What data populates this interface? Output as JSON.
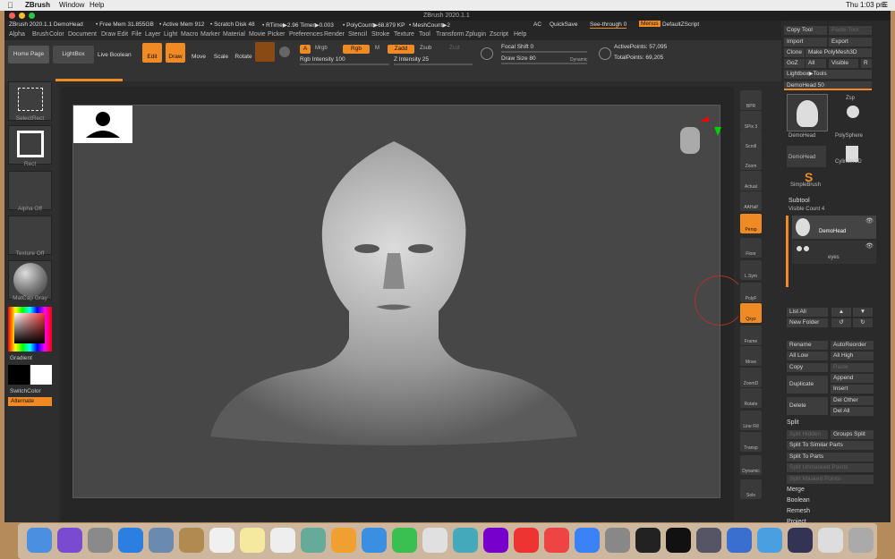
{
  "mac_menubar": {
    "app": "ZBrush",
    "window": "Window",
    "help": "Help",
    "clock": "Thu 1:03 pm"
  },
  "window": {
    "title": "ZBrush 2020.1.1"
  },
  "status_bar": {
    "app": "ZBrush 2020.1.1 DemoHead",
    "free_mem": "• Free Mem 31.855GB",
    "active_mem": "• Active Mem 912",
    "scratch": "• Scratch Disk 48",
    "rtime": "• RTime▶2.96 Timer▶0.003",
    "polycount": "• PolyCount▶68.879 KP",
    "meshcount": "• MeshCount▶2",
    "ac": "AC",
    "quicksave": "QuickSave",
    "seethrough": "See-through 0",
    "menus": "Menus",
    "script": "DefaultZScript"
  },
  "main_menu": [
    "Alpha",
    "Brush",
    "Color",
    "Document",
    "Draw",
    "Edit",
    "File",
    "Layer",
    "Light",
    "Macro",
    "Marker",
    "Material",
    "Movie",
    "Picker",
    "Preferences",
    "Render",
    "Stencil",
    "Stroke",
    "Texture",
    "Tool",
    "Transform",
    "Zplugin",
    "Zscript",
    "Help"
  ],
  "toolbar": {
    "home": "Home Page",
    "lightbox": "LightBox",
    "liveboolean": "Live Boolean",
    "edit": "Edit",
    "draw": "Draw",
    "move": "Move",
    "scale": "Scale",
    "rotate": "Rotate",
    "a": "A",
    "mrgb": "Mrgb",
    "rgb": "Rgb",
    "m": "M",
    "rgb_intensity": "Rgb Intensity 100",
    "zadd": "Zadd",
    "zsub": "Zsub",
    "zcut": "Zcut",
    "z_intensity": "Z Intensity 25",
    "focal_shift": "Focal Shift 0",
    "draw_size": "Draw Size 80",
    "dynamic": "Dynamic",
    "active_points": "ActivePoints: 57,095",
    "total_points": "TotalPoints: 69,205"
  },
  "left_panel": {
    "selectrect": "SelectRect",
    "rect": "Rect",
    "alpha_off": "Alpha Off",
    "texture_off": "Texture Off",
    "matcap": "MatCap Gray",
    "gradient": "Gradient",
    "switchcolor": "SwitchColor",
    "alternate": "Alternate"
  },
  "right_strip": [
    "BPR",
    "SPix 3",
    "Scroll",
    "Zoom",
    "Actual",
    "AAHalf",
    "Persp",
    "Floor",
    "L.Sym",
    "PolyF",
    "Qxyz",
    "Frame",
    "Move",
    "ZoomD",
    "Rotate",
    "Line Fill",
    "Transp",
    "Dynamic",
    "Solo"
  ],
  "right_panel": {
    "copy_tool": "Copy Tool",
    "paste_tool": "Paste Tool",
    "import": "Import",
    "export": "Export",
    "clone": "Clone",
    "make_polymesh": "Make PolyMesh3D",
    "goz": "GoZ",
    "all": "All",
    "visible": "Visible",
    "r": "R",
    "lightbox_tools": "Lightbox▶Tools",
    "demohead_slider": "DemoHead 50",
    "tools": [
      "DemoHead",
      "Zsp",
      "PolySphere",
      "DemoHead",
      "Cylinder3D",
      "SimpleBrush"
    ],
    "subtool": "Subtool",
    "visible_count": "Visible Count 4",
    "subtool_items": [
      "DemoHead",
      "eyes"
    ],
    "list_all": "List All",
    "new_folder": "New Folder",
    "rename": "Rename",
    "autoreorder": "AutoReorder",
    "all_low": "All Low",
    "all_high": "All High",
    "copy": "Copy",
    "paste": "Paste",
    "append": "Append",
    "duplicate": "Duplicate",
    "insert": "Insert",
    "delete": "Delete",
    "del_other": "Del Other",
    "del_all": "Del All",
    "split": "Split",
    "split_hidden": "Split Hidden",
    "groups_split": "Groups Split",
    "split_similar": "Split To Similar Parts",
    "split_parts": "Split To Parts",
    "split_unmasked": "Split Unmasked Points",
    "split_masked": "Split Masked Points",
    "merge": "Merge",
    "boolean": "Boolean",
    "remesh": "Remesh",
    "project": "Project"
  },
  "colors": {
    "accent": "#f08a24",
    "bg": "#2b2b2b",
    "panel": "#3d3d3d"
  }
}
